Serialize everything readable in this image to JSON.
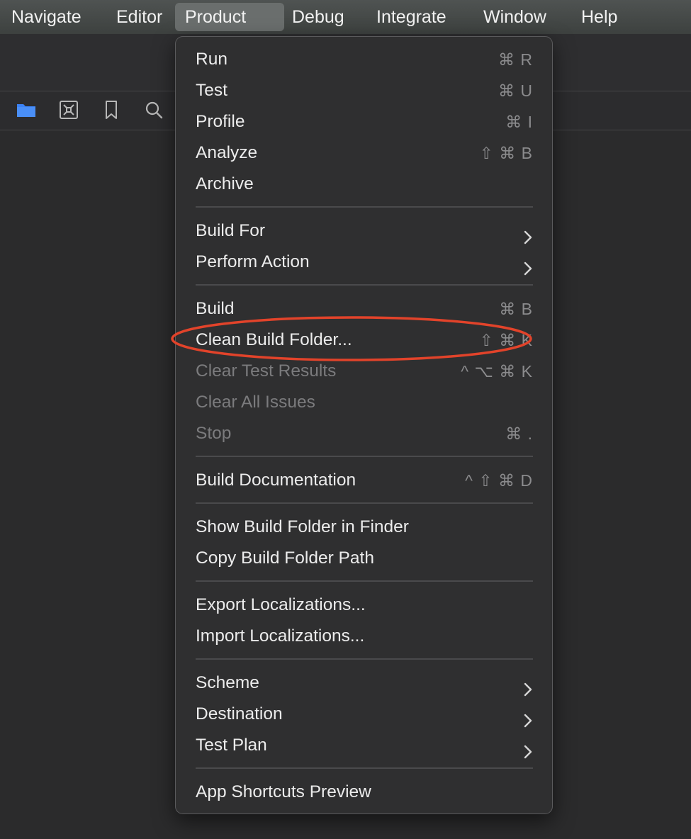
{
  "menubar": {
    "items": [
      {
        "label": "Navigate"
      },
      {
        "label": "Editor"
      },
      {
        "label": "Product"
      },
      {
        "label": "Debug"
      },
      {
        "label": "Integrate"
      },
      {
        "label": "Window"
      },
      {
        "label": "Help"
      }
    ],
    "active_index": 2
  },
  "navigator_icons": [
    "folder-icon",
    "source-control-icon",
    "bookmark-icon",
    "search-icon"
  ],
  "accent_colors": {
    "folder": "#3b82f6",
    "highlight_ring": "#e2432a"
  },
  "menu": {
    "items": [
      {
        "label": "Run",
        "shortcut": "⌘ R"
      },
      {
        "label": "Test",
        "shortcut": "⌘ U"
      },
      {
        "label": "Profile",
        "shortcut": "⌘ I"
      },
      {
        "label": "Analyze",
        "shortcut": "⇧ ⌘ B"
      },
      {
        "label": "Archive",
        "shortcut": ""
      },
      {
        "label": "Build For",
        "submenu": true
      },
      {
        "label": "Perform Action",
        "submenu": true
      },
      {
        "label": "Build",
        "shortcut": "⌘ B"
      },
      {
        "label": "Clean Build Folder...",
        "shortcut": "⇧ ⌘ K",
        "highlighted": true
      },
      {
        "label": "Clear Test Results",
        "shortcut": "^ ⌥ ⌘ K",
        "disabled": true
      },
      {
        "label": "Clear All Issues",
        "shortcut": "",
        "disabled": true
      },
      {
        "label": "Stop",
        "shortcut": "⌘ .",
        "disabled": true
      },
      {
        "label": "Build Documentation",
        "shortcut": "^ ⇧ ⌘ D"
      },
      {
        "label": "Show Build Folder in Finder",
        "shortcut": ""
      },
      {
        "label": "Copy Build Folder Path",
        "shortcut": ""
      },
      {
        "label": "Export Localizations...",
        "shortcut": ""
      },
      {
        "label": "Import Localizations...",
        "shortcut": ""
      },
      {
        "label": "Scheme",
        "submenu": true
      },
      {
        "label": "Destination",
        "submenu": true
      },
      {
        "label": "Test Plan",
        "submenu": true
      },
      {
        "label": "App Shortcuts Preview",
        "shortcut": ""
      }
    ]
  }
}
